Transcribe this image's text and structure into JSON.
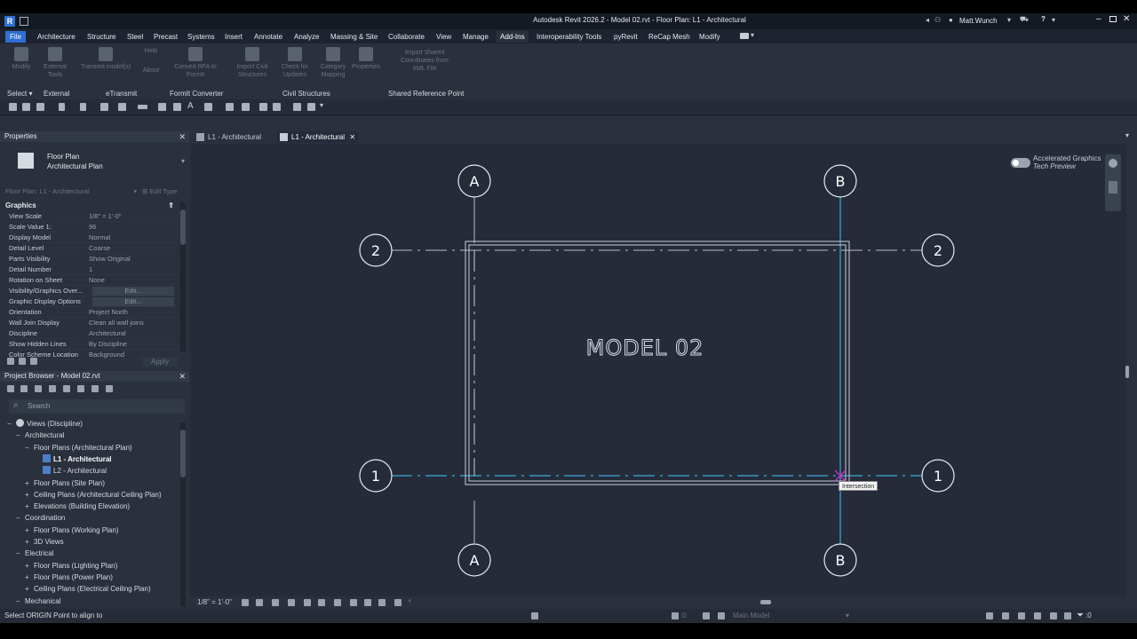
{
  "window": {
    "title": "Autodesk Revit 2026.2 - Model 02.rvt - Floor Plan: L1 - Architectural",
    "user": "Matt.Wunch"
  },
  "ribbon": {
    "file_tab": "File",
    "tabs": [
      "Architecture",
      "Structure",
      "Steel",
      "Precast",
      "Systems",
      "Insert",
      "Annotate",
      "Analyze",
      "Massing & Site",
      "Collaborate",
      "View",
      "Manage",
      "Add-Ins",
      "Interoperability Tools",
      "pyRevit",
      "ReCap Mesh",
      "Modify"
    ],
    "active_tab": "Add-Ins",
    "buttons": [
      {
        "label": "Modify"
      },
      {
        "label": "External Tools"
      },
      {
        "label": "Transmit model(s)"
      },
      {
        "label": "Help"
      },
      {
        "label": "About"
      },
      {
        "label": "Convert RFA to FormIt"
      },
      {
        "label": "Import Civil Structures"
      },
      {
        "label": "Check for Updates"
      },
      {
        "label": "Category Mapping"
      },
      {
        "label": "Properties"
      },
      {
        "label": "Import Shared Coordinates from XML File"
      }
    ],
    "panels": [
      "Select",
      "External",
      "eTransmit",
      "FormIt Converter",
      "Civil Structures",
      "Shared Reference Point"
    ]
  },
  "properties": {
    "title": "Properties",
    "type_name": "Floor Plan",
    "type_sub": "Architectural Plan",
    "instance_selector": "Floor Plan: L1 - Architectural",
    "edit_type": "Edit Type",
    "group": "Graphics",
    "rows": [
      {
        "k": "View Scale",
        "v": "1/8\" = 1'-0\""
      },
      {
        "k": "Scale Value    1:",
        "v": "96"
      },
      {
        "k": "Display Model",
        "v": "Normal"
      },
      {
        "k": "Detail Level",
        "v": "Coarse"
      },
      {
        "k": "Parts Visibility",
        "v": "Show Original"
      },
      {
        "k": "Detail Number",
        "v": "1"
      },
      {
        "k": "Rotation on Sheet",
        "v": "None"
      },
      {
        "k": "Visibility/Graphics Over...",
        "v": "Edit..."
      },
      {
        "k": "Graphic Display Options",
        "v": "Edit..."
      },
      {
        "k": "Orientation",
        "v": "Project North"
      },
      {
        "k": "Wall Join Display",
        "v": "Clean all wall joins"
      },
      {
        "k": "Discipline",
        "v": "Architectural"
      },
      {
        "k": "Show Hidden Lines",
        "v": "By Discipline"
      },
      {
        "k": "Color Scheme Location",
        "v": "Background"
      }
    ],
    "apply": "Apply"
  },
  "browser": {
    "title": "Project Browser - Model 02.rvt",
    "search_placeholder": "Search",
    "items": [
      {
        "t": "Views (Discipline)",
        "lvl": 0,
        "pm": "−"
      },
      {
        "t": "Architectural",
        "lvl": 1,
        "pm": "−"
      },
      {
        "t": "Floor Plans (Architectural Plan)",
        "lvl": 2,
        "pm": "−"
      },
      {
        "t": "L1 - Architectural",
        "lvl": 3,
        "pm": "",
        "sel": true
      },
      {
        "t": "L2 - Architectural",
        "lvl": 3,
        "pm": ""
      },
      {
        "t": "Floor Plans (Site Plan)",
        "lvl": 2,
        "pm": "+"
      },
      {
        "t": "Ceiling Plans (Architectural Ceiling Plan)",
        "lvl": 2,
        "pm": "+"
      },
      {
        "t": "Elevations (Building Elevation)",
        "lvl": 2,
        "pm": "+"
      },
      {
        "t": "Coordination",
        "lvl": 1,
        "pm": "−"
      },
      {
        "t": "Floor Plans (Working Plan)",
        "lvl": 2,
        "pm": "+"
      },
      {
        "t": "3D Views",
        "lvl": 2,
        "pm": "+"
      },
      {
        "t": "Electrical",
        "lvl": 1,
        "pm": "−"
      },
      {
        "t": "Floor Plans (Lighting Plan)",
        "lvl": 2,
        "pm": "+"
      },
      {
        "t": "Floor Plans (Power Plan)",
        "lvl": 2,
        "pm": "+"
      },
      {
        "t": "Ceiling Plans (Electrical Ceiling Plan)",
        "lvl": 2,
        "pm": "+"
      },
      {
        "t": "Mechanical",
        "lvl": 1,
        "pm": "−"
      }
    ]
  },
  "doc_tabs": [
    {
      "label": "L1 - Architectural",
      "active": false
    },
    {
      "label": "L1 - Architectural",
      "active": true
    }
  ],
  "canvas": {
    "model_text": "MODEL 02",
    "grid_a": "A",
    "grid_b": "B",
    "grid_1": "1",
    "grid_2": "2",
    "snap_tooltip": "Intersection",
    "accel_title": "Accelerated Graphics",
    "accel_sub": "Tech Preview"
  },
  "view_control": {
    "scale": "1/8\" = 1'-0\""
  },
  "status": {
    "prompt": "Select ORIGIN Point to align to",
    "worksets": ":0",
    "model": "Main Model",
    "filter": ":0"
  },
  "colors": {
    "accent": "#2f6fd4",
    "highlight": "#3aa9d8",
    "snap": "#d02ac4"
  }
}
